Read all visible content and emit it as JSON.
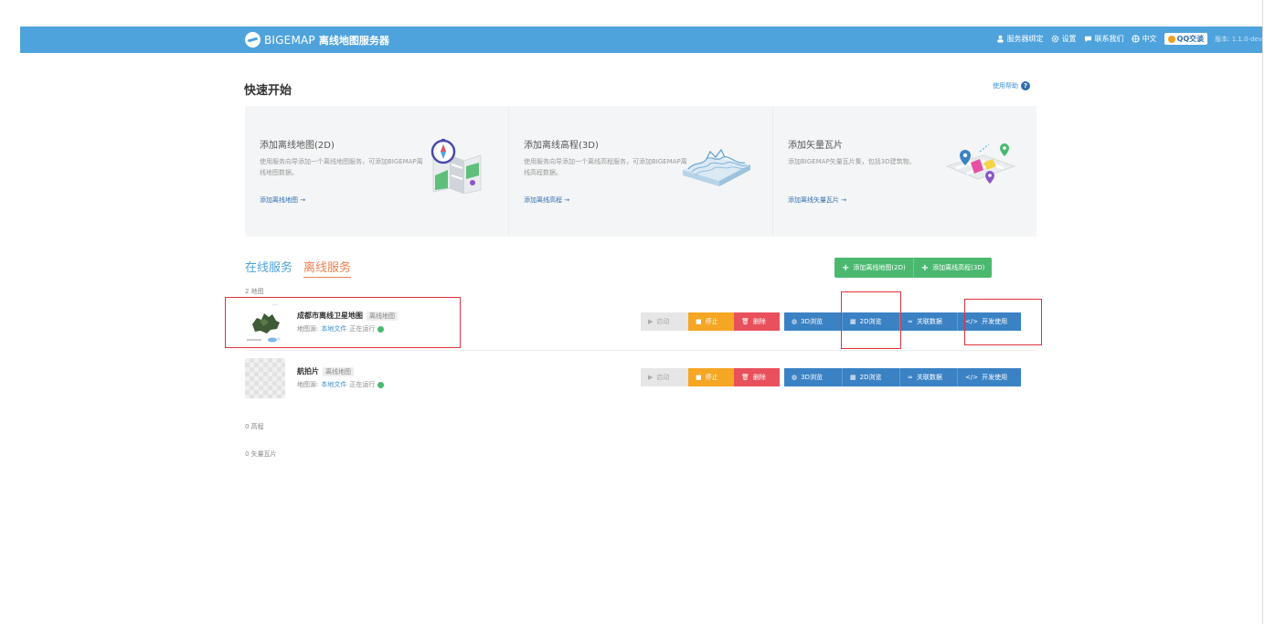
{
  "topbar": {
    "brand": "BIGEMAP",
    "product": "离线地图服务器",
    "nav": {
      "server_bind": "服务器绑定",
      "settings": "设置",
      "contact": "联系我们",
      "language": "中文",
      "qq": "QQ交谈",
      "version": "版本: 1.1.0-dev"
    }
  },
  "page": {
    "title": "快速开始",
    "help": "使用帮助"
  },
  "cards": [
    {
      "title": "添加离线地图(2D)",
      "desc": "使用服务向导添加一个离线地图服务，可添加BIGEMAP离线地图数据。",
      "link": "添加离线地图 →",
      "icon": "compass-map-icon"
    },
    {
      "title": "添加离线高程(3D)",
      "desc": "使用服务向导添加一个离线高程服务，可添加BIGEMAP离线高程数据。",
      "link": "添加离线高程 →",
      "icon": "terrain-icon"
    },
    {
      "title": "添加矢量瓦片",
      "desc": "添加BIGEMAP矢量瓦片集，包括3D建筑物。",
      "link": "添加离线矢量瓦片 →",
      "icon": "vector-pin-icon"
    }
  ],
  "tabs": {
    "online": "在线服务",
    "offline": "离线服务"
  },
  "add_buttons": {
    "add_map": "添加离线地图(2D)",
    "add_elevation": "添加离线高程(3D)"
  },
  "counts": {
    "maps": "2 地图",
    "elevation": "0 高程",
    "vector": "0 矢量瓦片"
  },
  "services": [
    {
      "name": "成都市离线卫星地图",
      "tag": "离线地图",
      "source_label": "地图源:",
      "source": "本地文件",
      "status": "正在运行",
      "thumbnail": "map-thumbnail"
    },
    {
      "name": "航拍片",
      "tag": "离线地图",
      "source_label": "地图源:",
      "source": "本地文件",
      "status": "正在运行",
      "thumbnail": "blank-thumbnail"
    }
  ],
  "row_buttons": {
    "start": "启动",
    "stop": "停止",
    "delete": "删除",
    "preview_3d": "3D浏览",
    "preview_2d": "2D浏览",
    "related_data": "关联数据",
    "dev_use": "开发使用"
  },
  "colors": {
    "topbar": "#4fa3dd",
    "green": "#4bb870",
    "orange": "#f5a623",
    "red": "#e8505b",
    "blue": "#3b82c4",
    "highlight": "#e0323a"
  }
}
